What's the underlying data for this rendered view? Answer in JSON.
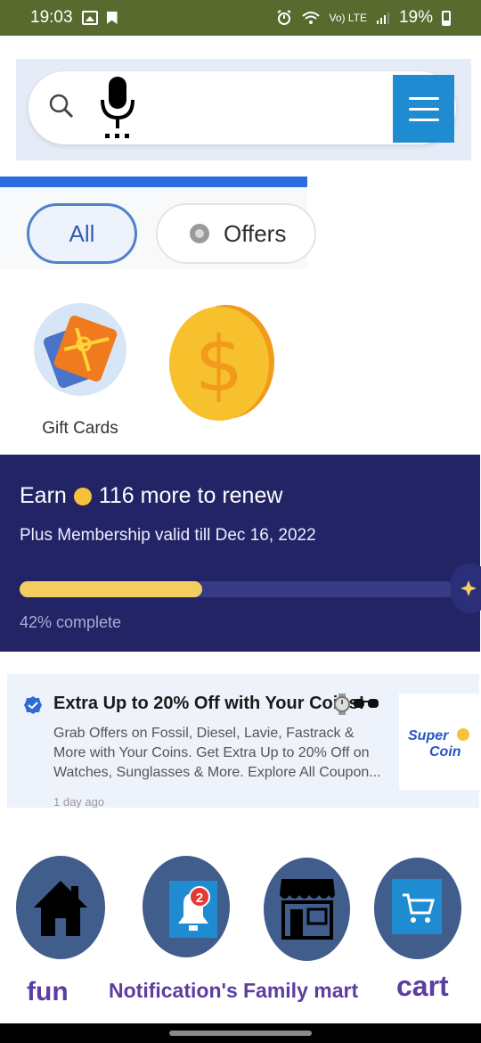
{
  "status_bar": {
    "time": "19:03",
    "network_label": "Vo) LTE",
    "battery": "19%"
  },
  "search": {
    "menu_icon": "hamburger-menu-icon"
  },
  "tabs": [
    {
      "label": "All",
      "selected": true
    },
    {
      "label": "Offers",
      "selected": false
    }
  ],
  "shortcuts": [
    {
      "label": "Gift Cards",
      "icon": "gift-card-icon"
    },
    {
      "label": "",
      "icon": "dollar-coin-icon"
    }
  ],
  "membership": {
    "title_prefix": "Earn",
    "title_suffix": "116 more to renew",
    "subtitle": "Plus Membership valid till Dec 16, 2022",
    "progress": 0.42,
    "progress_label": "42% complete"
  },
  "offer": {
    "title": "Extra Up to 20% Off with Your Coins!",
    "description": "Grab Offers on Fossil, Diesel, Lavie, Fastrack & More with Your Coins. Get Extra Up to 20% Off on Watches, Sunglasses & More. Explore All Coupon...",
    "time": "1 day ago",
    "logo_line1": "Super",
    "logo_line2": "Coin"
  },
  "bottom_nav": [
    {
      "label": "fun",
      "icon": "home-icon"
    },
    {
      "label": "Notification's",
      "icon": "notification-bell-icon",
      "badge": "2"
    },
    {
      "label": "Family mart",
      "icon": "storefront-icon"
    },
    {
      "label": "cart",
      "icon": "cart-icon"
    }
  ],
  "colors": {
    "status_bar": "#596a2e",
    "accent_blue": "#1f8bd0",
    "membership_bg": "#222466",
    "progress_fill": "#f3cd60",
    "nav_circle": "#405d8c",
    "nav_label": "#5b3ea0"
  }
}
